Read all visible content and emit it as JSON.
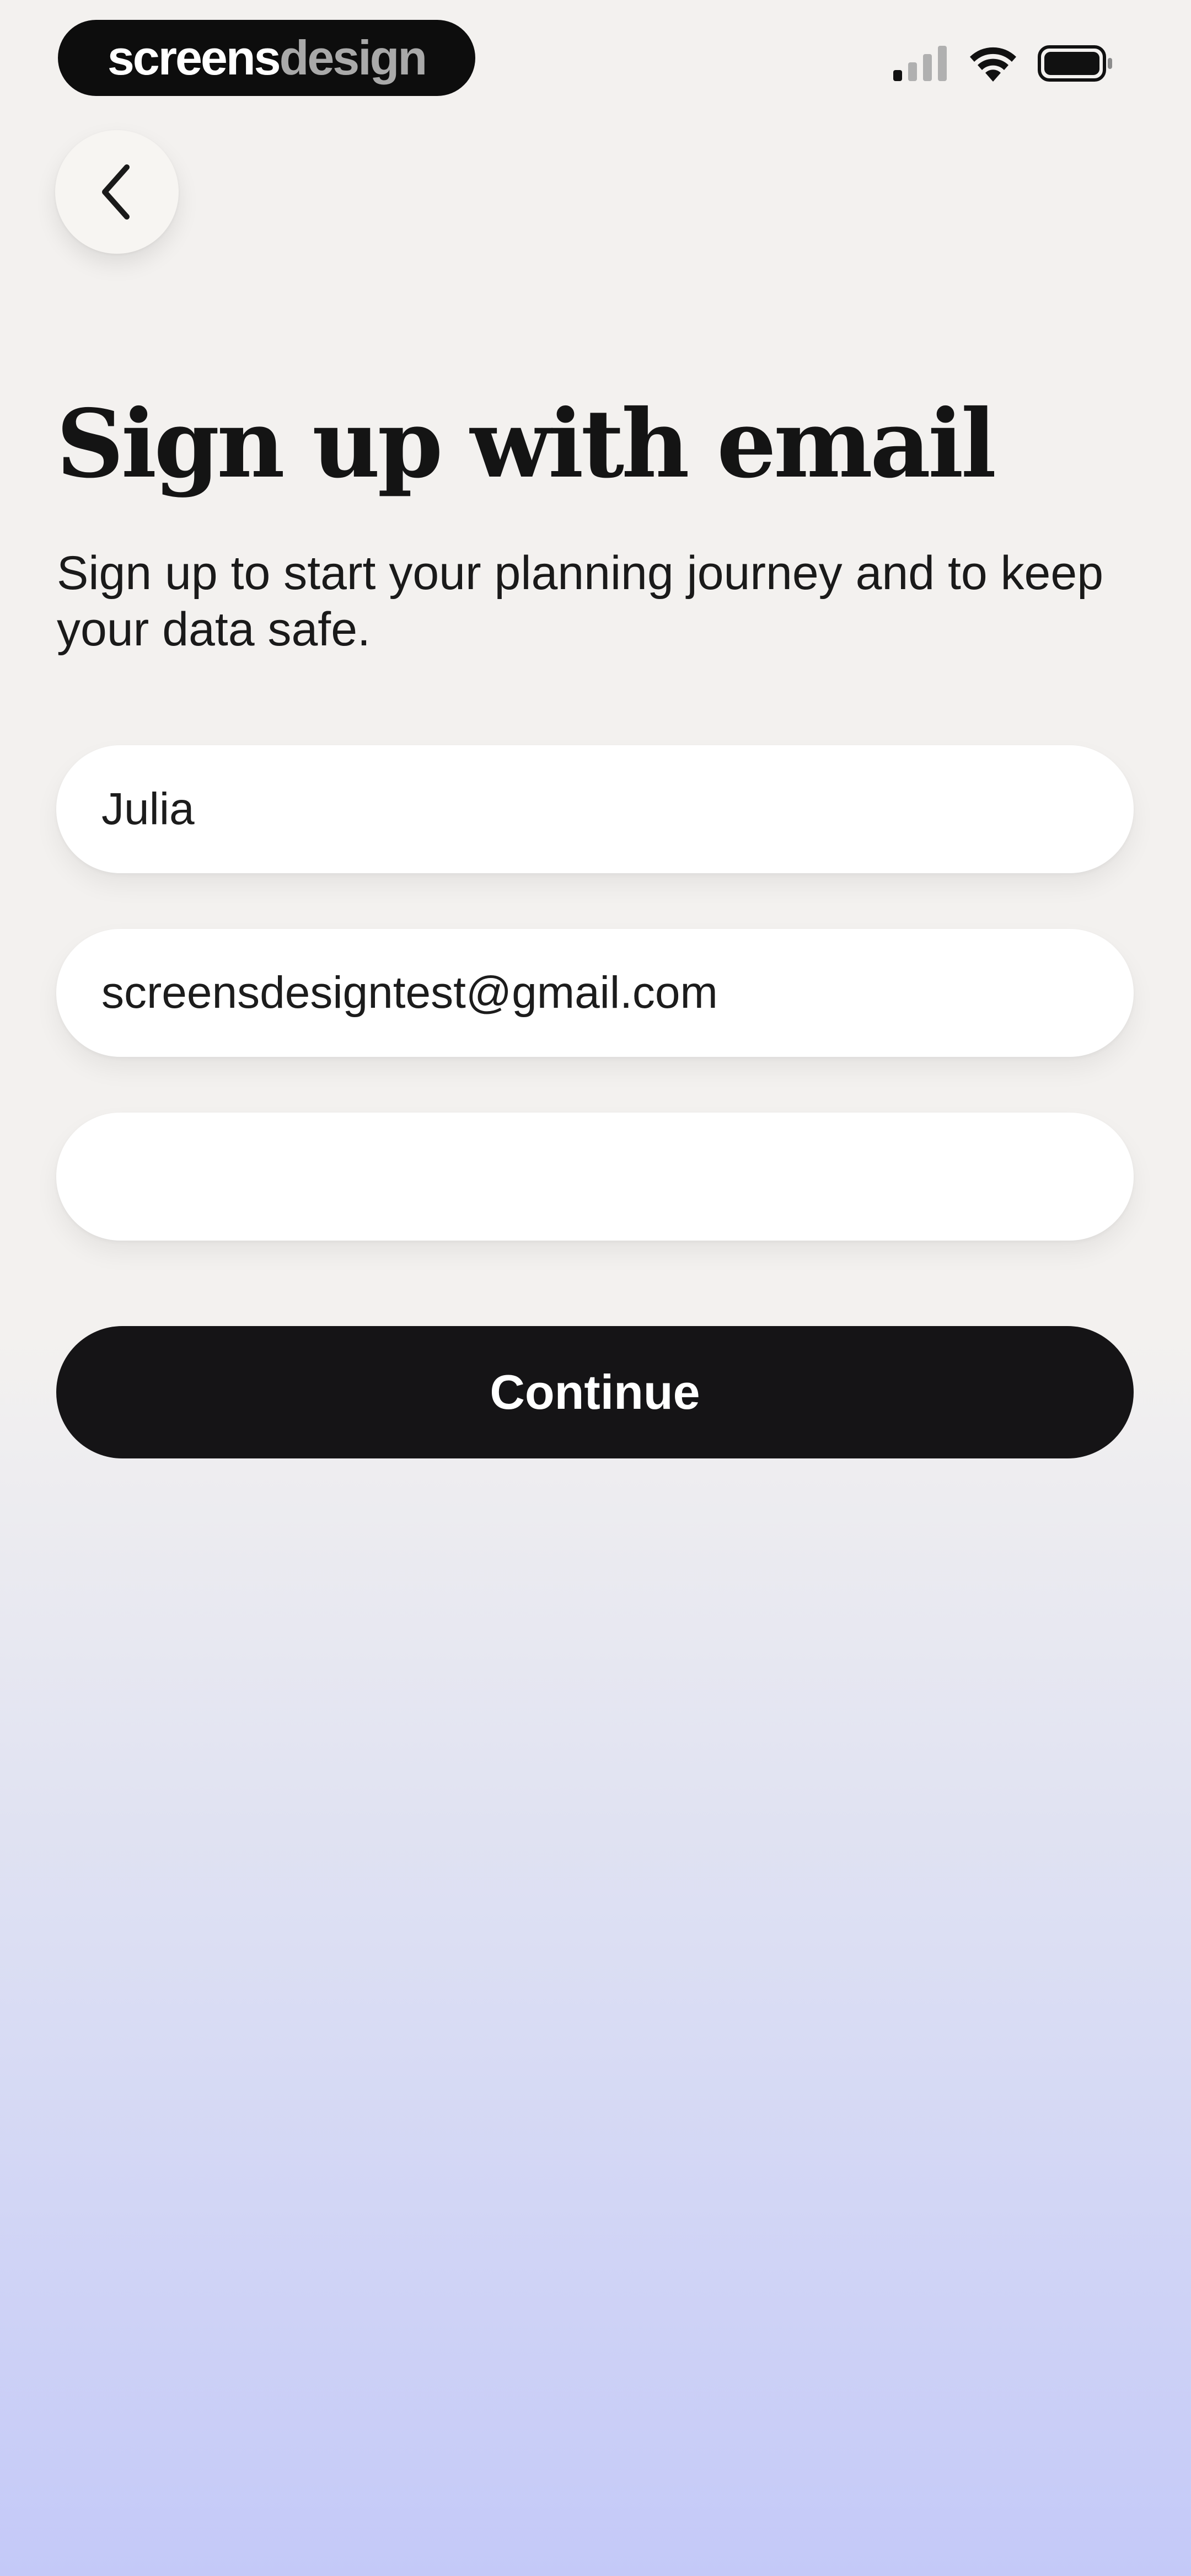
{
  "status_bar": {
    "brand_primary": "screens",
    "brand_secondary": "design",
    "icons": [
      "cellular-signal-icon",
      "wifi-icon",
      "battery-icon"
    ]
  },
  "nav": {
    "back_icon": "chevron-left-icon"
  },
  "page": {
    "title": "Sign up with email",
    "subtitle": "Sign up to start your planning journey and to keep your data safe."
  },
  "form": {
    "name_value": "Julia",
    "email_value": "screensdesigntest@gmail.com",
    "password_value": "",
    "continue_label": "Continue"
  },
  "colors": {
    "background_top": "#f3f1ef",
    "background_bottom": "#c4c9f8",
    "button": "#151416",
    "field": "#ffffff"
  }
}
